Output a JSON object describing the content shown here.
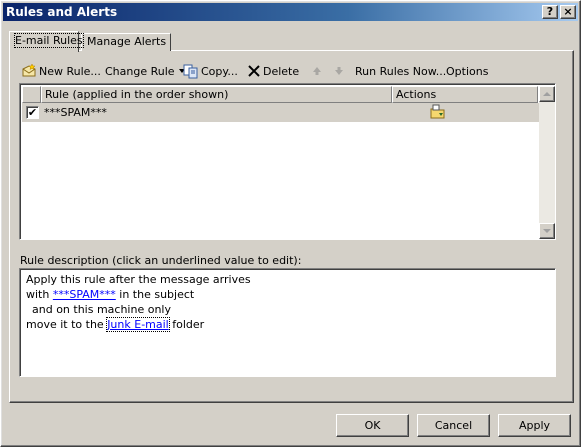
{
  "window": {
    "title": "Rules and Alerts",
    "help_glyph": "?",
    "close_glyph": "×"
  },
  "tabs": [
    {
      "label": "E-mail Rules"
    },
    {
      "label": "Manage Alerts"
    }
  ],
  "toolbar": {
    "new_rule": "New Rule...",
    "change_rule": "Change Rule",
    "copy": "Copy...",
    "delete": "Delete",
    "run_rules_now": "Run Rules Now...",
    "options": "Options"
  },
  "rule_list": {
    "columns": {
      "rule": "Rule (applied in the order shown)",
      "actions": "Actions"
    },
    "rows": [
      {
        "name": "***SPAM***",
        "enabled": true,
        "check_glyph": "✔"
      }
    ]
  },
  "description": {
    "label": "Rule description (click an underlined value to edit):",
    "line1": "Apply this rule after the message arrives",
    "line2_prefix": "with ",
    "line2_link": "***SPAM***",
    "line2_suffix": " in the subject",
    "line3": "and on this machine only",
    "line4_prefix": "move it to the ",
    "line4_link": "Junk E-mail",
    "line4_suffix": " folder"
  },
  "buttons": {
    "ok": "OK",
    "cancel": "Cancel",
    "apply": "Apply"
  }
}
